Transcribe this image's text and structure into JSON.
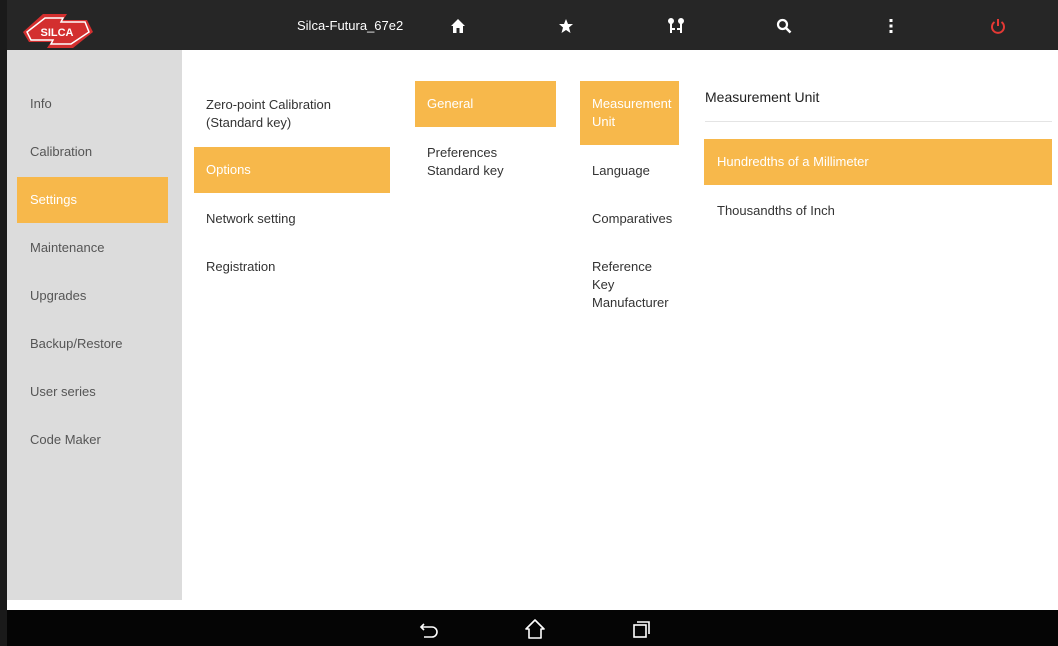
{
  "topbar": {
    "device_name": "Silca-Futura_67e2",
    "logo_text": "SILCA",
    "icons": [
      "home-icon",
      "star-icon",
      "keys-icon",
      "search-icon",
      "more-vertical-icon",
      "power-icon"
    ]
  },
  "sidebar": {
    "items": [
      {
        "label": "Info"
      },
      {
        "label": "Calibration"
      },
      {
        "label": "Settings"
      },
      {
        "label": "Maintenance"
      },
      {
        "label": "Upgrades"
      },
      {
        "label": "Backup/Restore"
      },
      {
        "label": "User series"
      },
      {
        "label": "Code Maker"
      }
    ],
    "selected": "Settings"
  },
  "settings_menu": {
    "items": [
      {
        "label": "Zero-point Calibration\n(Standard key)"
      },
      {
        "label": "Options"
      },
      {
        "label": "Network setting"
      },
      {
        "label": "Registration"
      }
    ],
    "selected": "Options"
  },
  "options_menu": {
    "items": [
      {
        "label": "General"
      },
      {
        "label": "Preferences\nStandard key"
      }
    ],
    "selected": "General"
  },
  "general_menu": {
    "items": [
      {
        "label": "Measurement\nUnit"
      },
      {
        "label": "Language"
      },
      {
        "label": "Comparatives"
      },
      {
        "label": "Reference\nKey\nManufacturer"
      }
    ],
    "selected": "Measurement Unit"
  },
  "measurement_unit": {
    "heading": "Measurement Unit",
    "options": [
      {
        "label": "Hundredths of a Millimeter"
      },
      {
        "label": "Thousandths of Inch"
      }
    ],
    "selected": "Hundredths of a Millimeter"
  },
  "colors": {
    "accent": "#f7b84b",
    "topbar": "#262626",
    "sidebar": "#dcdcdc",
    "power": "#e53935"
  },
  "navbar": {
    "icons": [
      "back-icon",
      "home-outline-icon",
      "recent-apps-icon"
    ]
  }
}
